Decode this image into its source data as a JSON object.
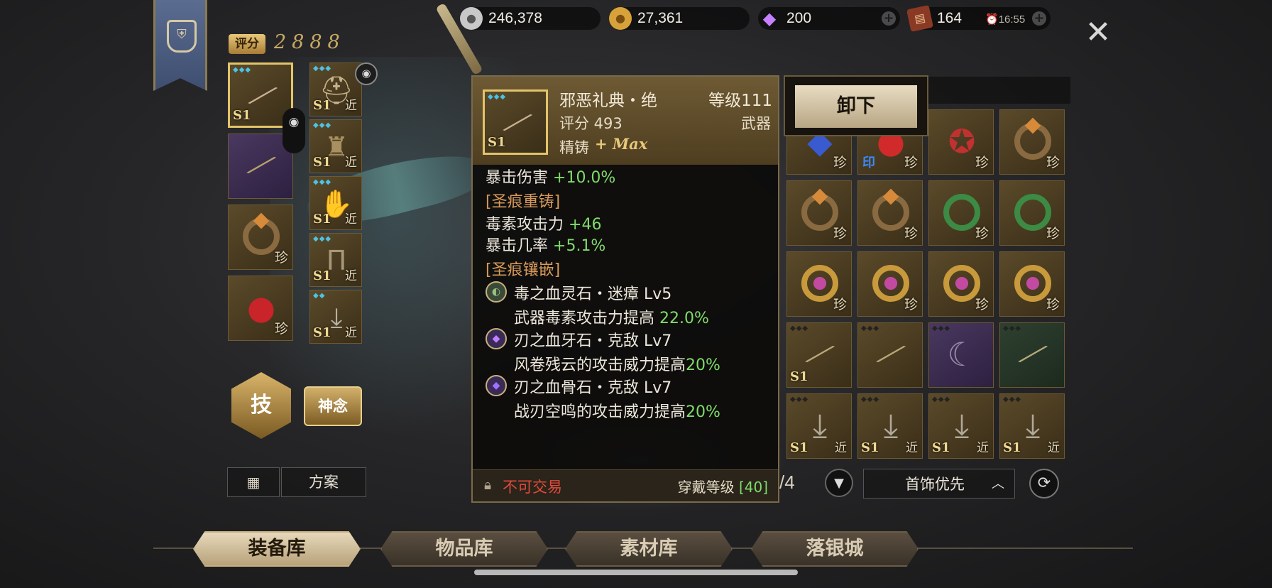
{
  "currencies": {
    "silver": "246,378",
    "gold": "27,361",
    "diamond": "200",
    "ticket": "164",
    "ticket_timer": "16:55"
  },
  "score": {
    "label": "评分",
    "value": "2888"
  },
  "equip_slots": {
    "big": [
      {
        "tier": "S1",
        "tag": "",
        "icon": "spear-icon"
      },
      {
        "tier": "",
        "tag": "",
        "icon": "scythe-icon"
      },
      {
        "tier": "",
        "tag": "珍",
        "icon": "ring-icon"
      },
      {
        "tier": "",
        "tag": "珍",
        "icon": "amulet-icon"
      }
    ],
    "small": [
      {
        "tier": "S1",
        "tag": "近"
      },
      {
        "tier": "S1",
        "tag": "近"
      },
      {
        "tier": "S1",
        "tag": "近"
      },
      {
        "tier": "S1",
        "tag": "近"
      },
      {
        "tier": "S1",
        "tag": "近"
      }
    ]
  },
  "buttons": {
    "skill": "技",
    "mind": "神念",
    "plan": "方案",
    "unequip": "卸下",
    "sort": "首饰优先"
  },
  "tooltip": {
    "name": "邪恶礼典・绝",
    "level": "等级111",
    "score": "评分 493",
    "type": "武器",
    "forge": "精铸",
    "forge_plus": "+ Max",
    "crit_damage": "暴击伤害",
    "crit_damage_val": "+10.0%",
    "section_recast": "[圣痕重铸]",
    "poison_atk": "毒素攻击力",
    "poison_atk_val": "+46",
    "crit_rate": "暴击几率",
    "crit_rate_val": "+5.1%",
    "section_inlay": "[圣痕镶嵌]",
    "gem1": "毒之血灵石・迷瘴 Lv5",
    "gem1_desc": "武器毒素攻击力提高",
    "gem1_val": "22.0%",
    "gem2": "刃之血牙石・克敌 Lv7",
    "gem2_desc": "风卷残云的攻击威力提高",
    "gem2_val": "20%",
    "gem3": "刃之血骨石・克敌 Lv7",
    "gem3_desc": "战刃空鸣的攻击威力提高",
    "gem3_val": "20%",
    "not_tradable": "不可交易",
    "wear_level": "穿戴等级",
    "wear_level_val": "[40]"
  },
  "inventory": {
    "rows": [
      [
        {
          "tag": "珍",
          "kind": "gem"
        },
        {
          "tag": "珍",
          "kind": "amulet",
          "mark": "印"
        },
        {
          "tag": "珍",
          "kind": "badge"
        },
        {
          "tag": "珍",
          "kind": "ring"
        }
      ],
      [
        {
          "tag": "珍",
          "kind": "ring"
        },
        {
          "tag": "珍",
          "kind": "ring"
        },
        {
          "tag": "珍",
          "kind": "ring-green"
        },
        {
          "tag": "珍",
          "kind": "ring-green"
        }
      ],
      [
        {
          "tag": "珍",
          "kind": "ring-gold"
        },
        {
          "tag": "珍",
          "kind": "ring-gold"
        },
        {
          "tag": "珍",
          "kind": "ring-gold"
        },
        {
          "tag": "珍",
          "kind": "ring-gold"
        }
      ],
      [
        {
          "tag": "S1",
          "kind": "spear"
        },
        {
          "tag": "",
          "kind": "spear"
        },
        {
          "tag": "",
          "kind": "scythe"
        },
        {
          "tag": "",
          "kind": "spear"
        }
      ],
      [
        {
          "tag": "S1",
          "near": "近",
          "kind": "armor"
        },
        {
          "tag": "S1",
          "near": "近",
          "kind": "armor"
        },
        {
          "tag": "S1",
          "near": "近",
          "kind": "armor"
        },
        {
          "tag": "S1",
          "near": "近",
          "kind": "armor"
        }
      ]
    ],
    "page": "/4"
  },
  "tabs": [
    "装备库",
    "物品库",
    "素材库",
    "落银城"
  ],
  "active_tab": 0
}
